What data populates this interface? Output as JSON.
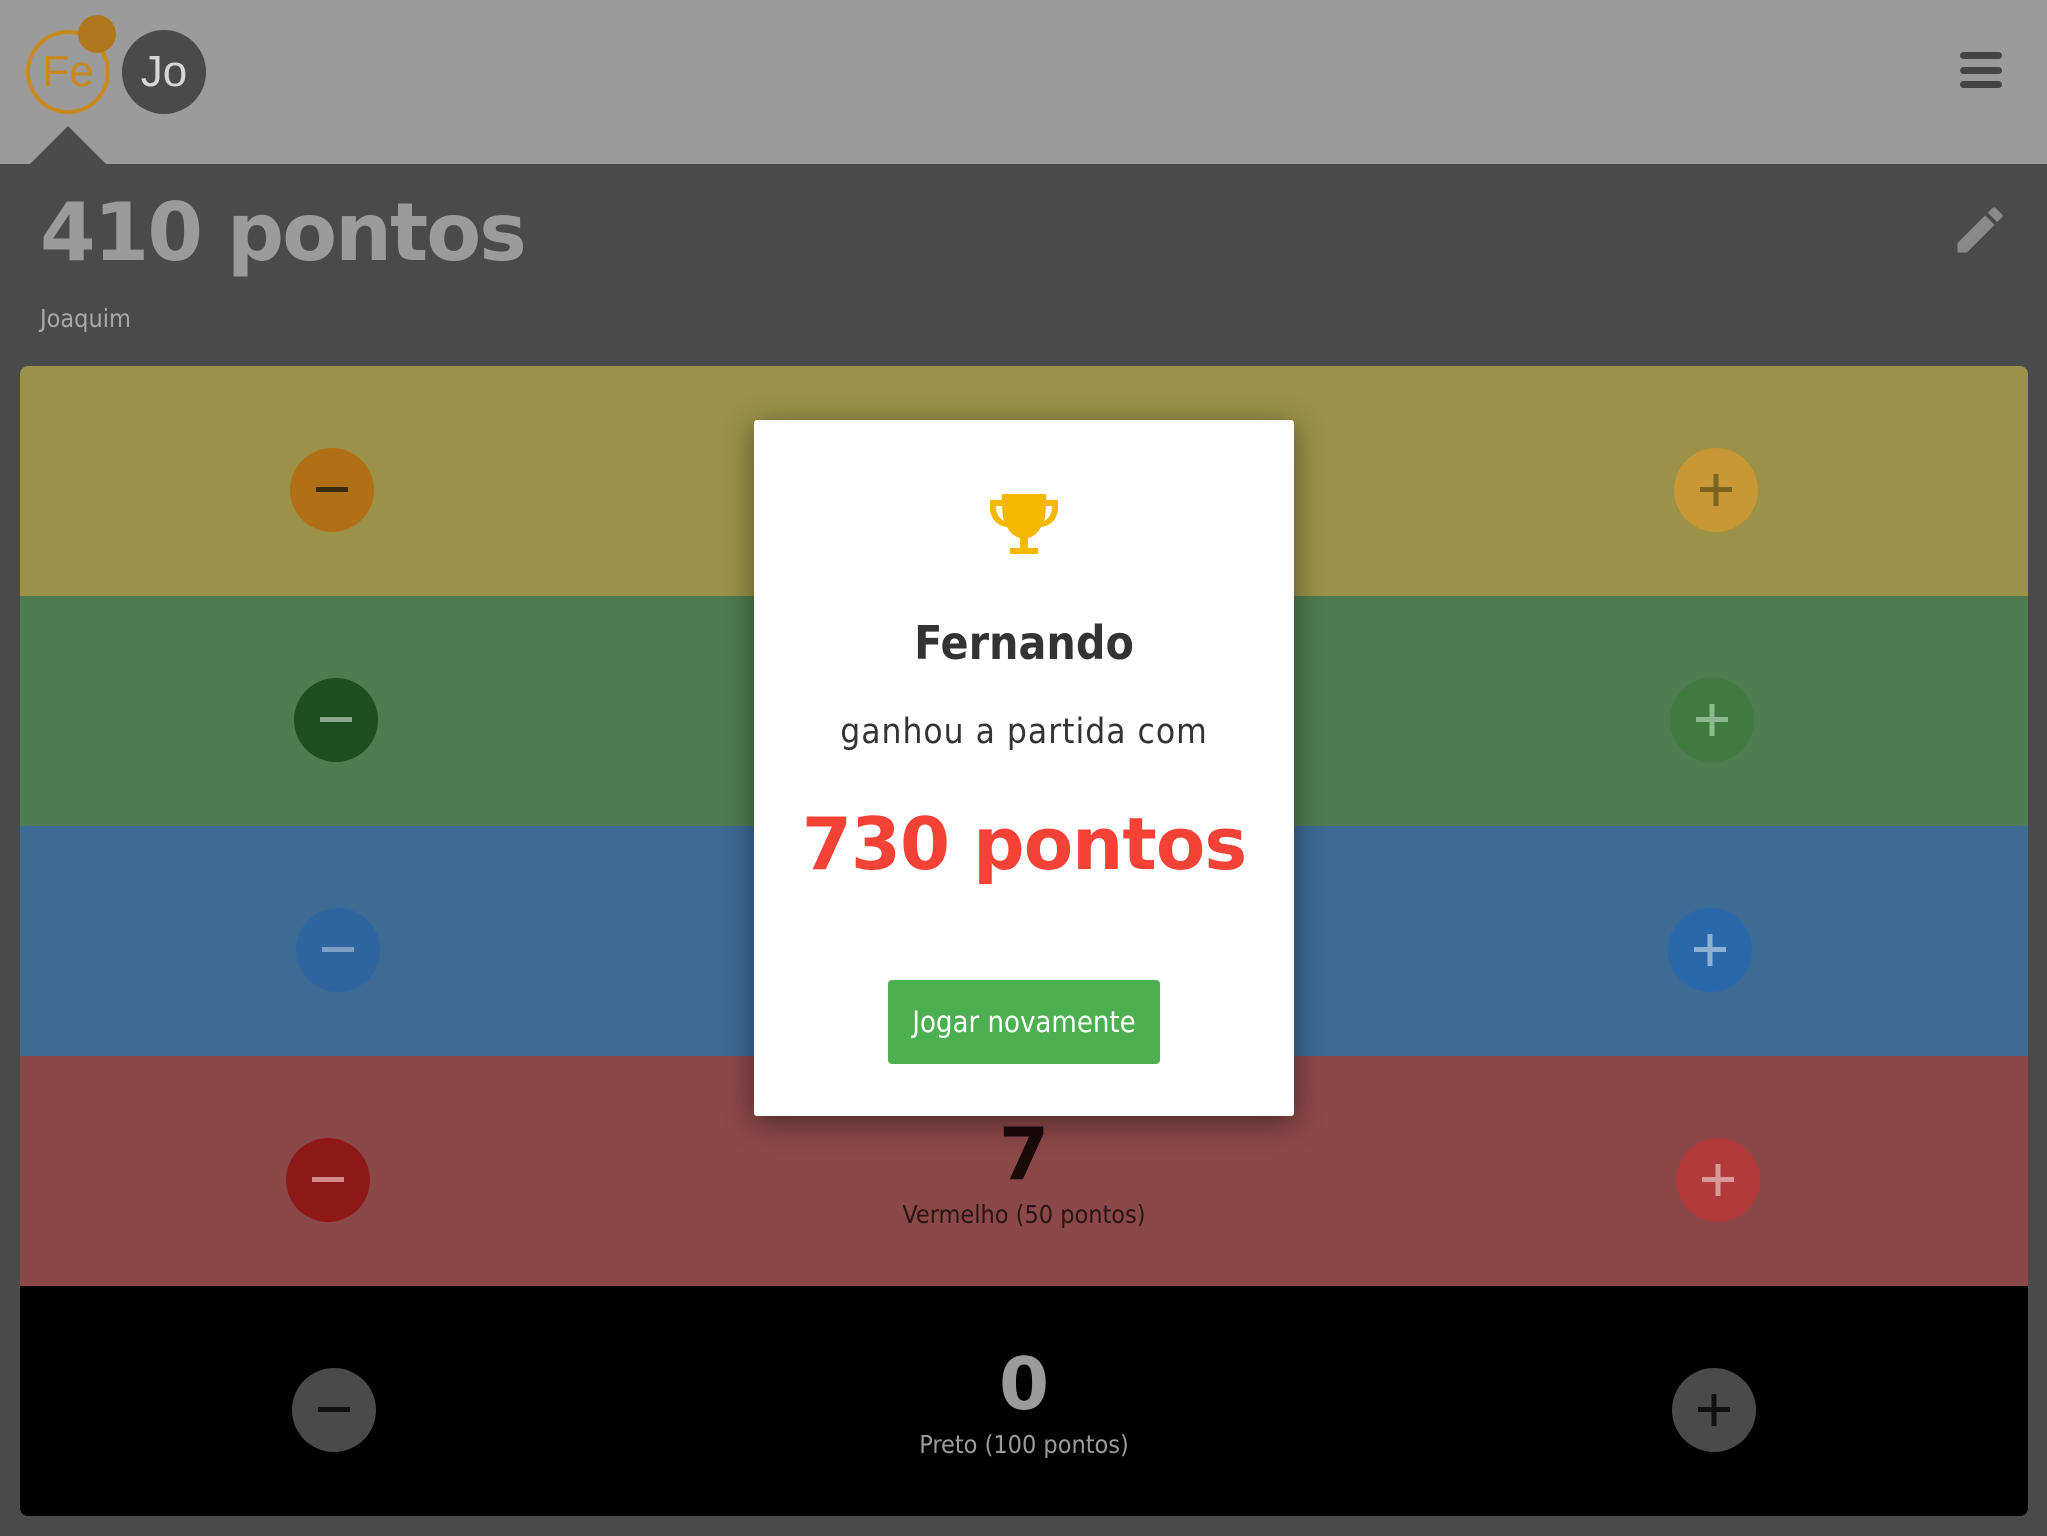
{
  "topbar": {
    "players": [
      {
        "initials": "Fe",
        "active": true,
        "has_badge": true
      },
      {
        "initials": "Jo",
        "active": false
      }
    ],
    "menu_icon": "hamburger-menu-icon"
  },
  "header": {
    "score_text": "410 pontos",
    "player_name": "Joaquim",
    "edit_icon": "pencil-icon"
  },
  "rows": [
    {
      "name": "yellow",
      "count": "",
      "label": "",
      "bg": "#9b9148",
      "minus_color": "#b27016",
      "plus_color": "#c79833"
    },
    {
      "name": "green",
      "count": "",
      "label": "",
      "bg": "#4f7b50",
      "minus_color": "#1e4d20",
      "plus_color": "#3f7a40"
    },
    {
      "name": "blue",
      "count": "",
      "label": "",
      "bg": "#3d6b94",
      "minus_color": "#2f66a2",
      "plus_color": "#2a68ac"
    },
    {
      "name": "red",
      "count": "7",
      "label": "Vermelho (50 pontos)",
      "bg": "#8b4848",
      "minus_color": "#8e1818",
      "plus_color": "#b23a3a"
    },
    {
      "name": "black",
      "count": "0",
      "label": "Preto (100 pontos)",
      "bg": "#000000",
      "minus_color": "#4a4a4a",
      "plus_color": "#4a4a4a"
    }
  ],
  "modal": {
    "icon": "trophy-icon",
    "winner": "Fernando",
    "won_text": "ganhou a partida com",
    "won_points": "730 pontos",
    "play_again_label": "Jogar novamente"
  },
  "colors": {
    "topbar_bg": "#9b9b9b",
    "page_bg": "#4a4a4a",
    "accent_orange": "#c88a1e",
    "trophy": "#f5b800",
    "points_red": "#f44336",
    "button_green": "#4caf50"
  }
}
